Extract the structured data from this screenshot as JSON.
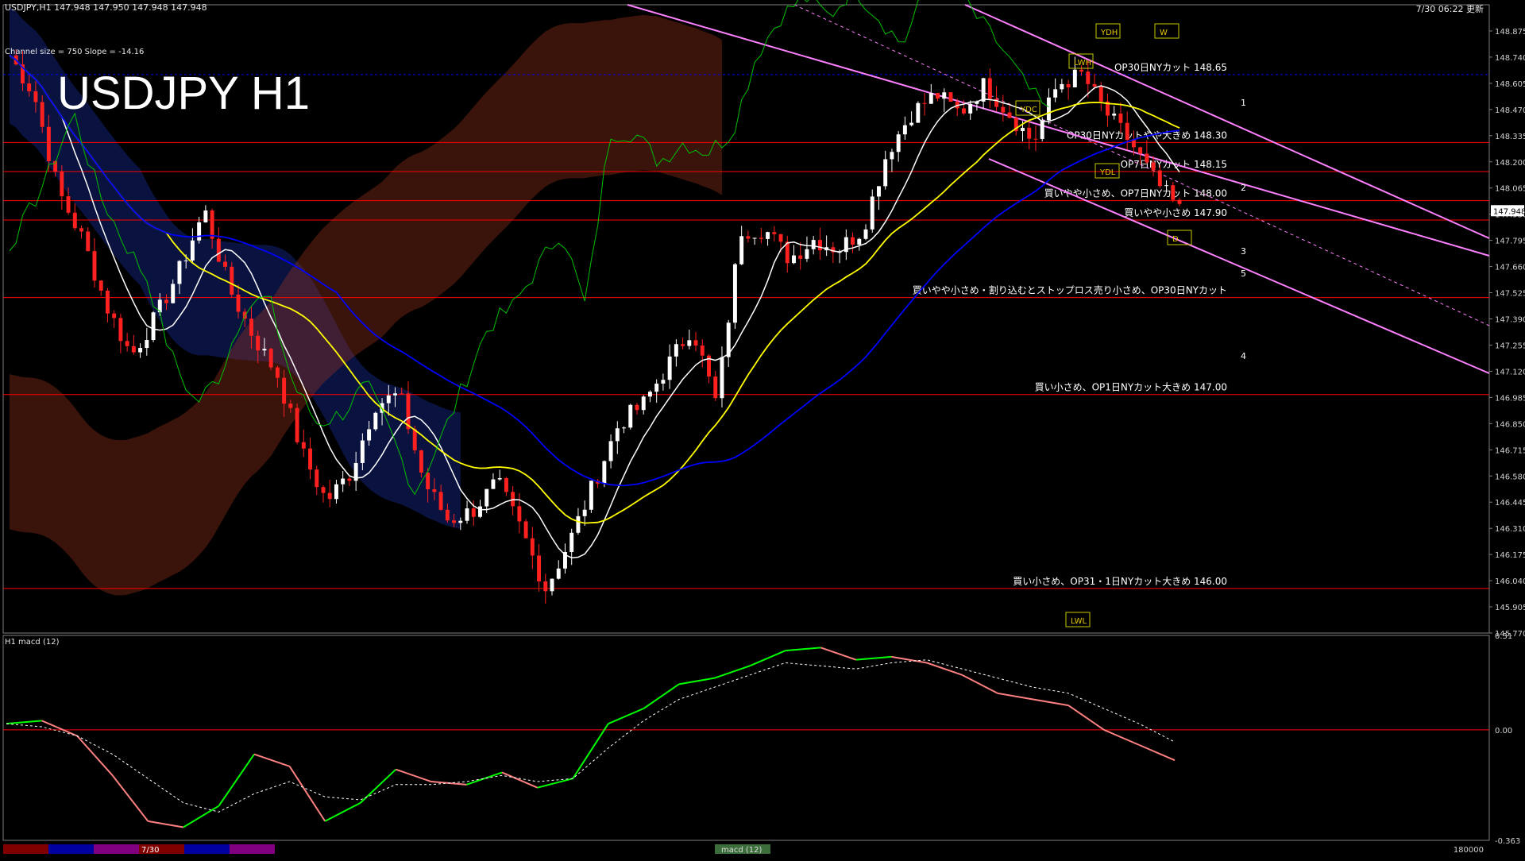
{
  "header": {
    "symbol_info": "USDJPY,H1  147.948 147.950 147.948 147.948",
    "timestamp": "7/30 06:22 更新",
    "channel_info": "Channel size = 750 Slope = -14.16",
    "big_title": "USDJPY H1",
    "macd_label": "H1  macd (12)"
  },
  "colors": {
    "background": "#000000",
    "grid_border": "#7f7f7f",
    "bull_candle": "#ffffff",
    "bear_candle": "#ff2020",
    "sma_fast": "#ffffff",
    "sma_mid": "#ffff00",
    "sma_slow": "#0000ff",
    "chikou": "#00c000",
    "channel": "#ff80ff",
    "cloud_top": "#c8c800",
    "macd_up": "#00ff00",
    "macd_down": "#ff8080",
    "signal": "#ffffff",
    "level_line": "#ff0000"
  },
  "chart_data": [
    {
      "type": "line",
      "name": "price",
      "ylim": [
        145.77,
        149.01
      ],
      "y_ticks": [
        "148.875",
        "148.740",
        "148.605",
        "148.470",
        "148.335",
        "148.200",
        "148.065",
        "147.930",
        "147.795",
        "147.660",
        "147.525",
        "147.390",
        "147.255",
        "147.120",
        "146.985",
        "146.850",
        "146.715",
        "146.580",
        "146.445",
        "146.310",
        "146.175",
        "146.040",
        "145.905",
        "145.770"
      ],
      "y_tick_values": [
        148.875,
        148.74,
        148.605,
        148.47,
        148.335,
        148.2,
        148.065,
        147.93,
        147.795,
        147.66,
        147.525,
        147.39,
        147.255,
        147.12,
        146.985,
        146.85,
        146.715,
        146.58,
        146.445,
        146.31,
        146.175,
        146.04,
        145.905,
        145.77
      ],
      "current_price": "147.948",
      "current_price_value": 147.948,
      "close_path": [
        148.75,
        148.55,
        148.05,
        147.8,
        147.45,
        147.2,
        147.4,
        147.65,
        147.95,
        147.55,
        147.3,
        147.1,
        146.7,
        146.45,
        146.6,
        146.95,
        147.0,
        146.55,
        146.35,
        146.4,
        146.55,
        146.3,
        146.0,
        146.25,
        146.55,
        146.85,
        146.95,
        147.15,
        147.35,
        146.95,
        147.85,
        147.85,
        147.7,
        147.8,
        147.75,
        147.85,
        148.25,
        148.45,
        148.55,
        148.45,
        148.6,
        148.45,
        148.3,
        148.6,
        148.65,
        148.45,
        148.3,
        148.1,
        147.95
      ],
      "levels": [
        {
          "value": 148.65,
          "label": "OP30日NYカット 148.65",
          "color": "#0000ff",
          "style": "dashed"
        },
        {
          "value": 148.3,
          "label": "OP30日NYカットやや大きめ 148.30",
          "color": "#ff0000",
          "style": "solid"
        },
        {
          "value": 148.15,
          "label": "OP7日NYカット 148.15",
          "color": "#ff0000",
          "style": "solid"
        },
        {
          "value": 148.0,
          "label": "買いやや小さめ、OP7日NYカット 148.00",
          "color": "#ff0000",
          "style": "solid"
        },
        {
          "value": 147.9,
          "label": "買いやや小さめ 147.90",
          "color": "#ff0000",
          "style": "solid"
        },
        {
          "value": 147.5,
          "label": "買いやや小さめ・割り込むとストップロス売り小さめ、OP30日NYカット",
          "color": "#ff0000",
          "style": "solid"
        },
        {
          "value": 147.0,
          "label": "買い小さめ、OP1日NYカット大きめ 147.00",
          "color": "#ff0000",
          "style": "solid"
        },
        {
          "value": 146.0,
          "label": "買い小さめ、OP31・1日NYカット大きめ 146.00",
          "color": "#ff0000",
          "style": "solid"
        }
      ],
      "marker_labels": [
        "YDH",
        "W",
        "LWH",
        "YDC",
        "YDL",
        "D",
        "LWL"
      ],
      "channel_numbers": [
        "1",
        "2",
        "3",
        "5",
        "4"
      ]
    },
    {
      "type": "line",
      "name": "macd (12)",
      "ylim": [
        -0.363,
        0.31
      ],
      "y_ticks": [
        "0.31",
        "0.00",
        "-0.363"
      ],
      "y_tick_values": [
        0.31,
        0.0,
        -0.363
      ],
      "macd": [
        0.02,
        0.03,
        -0.02,
        -0.15,
        -0.3,
        -0.32,
        -0.25,
        -0.08,
        -0.12,
        -0.3,
        -0.24,
        -0.13,
        -0.17,
        -0.18,
        -0.14,
        -0.19,
        -0.16,
        0.02,
        0.07,
        0.15,
        0.17,
        0.21,
        0.26,
        0.27,
        0.23,
        0.24,
        0.22,
        0.18,
        0.12,
        0.1,
        0.08,
        0.0,
        -0.05,
        -0.1
      ],
      "signal": [
        0.02,
        0.01,
        -0.02,
        -0.08,
        -0.16,
        -0.24,
        -0.27,
        -0.21,
        -0.17,
        -0.22,
        -0.23,
        -0.18,
        -0.18,
        -0.17,
        -0.15,
        -0.17,
        -0.16,
        -0.06,
        0.03,
        0.1,
        0.14,
        0.18,
        0.22,
        0.21,
        0.2,
        0.22,
        0.23,
        0.2,
        0.17,
        0.14,
        0.12,
        0.07,
        0.02,
        -0.04
      ]
    }
  ],
  "bottom_bar": {
    "date_label": "7/30",
    "indicator_tab": "macd (12)",
    "volume_label": "180000"
  }
}
